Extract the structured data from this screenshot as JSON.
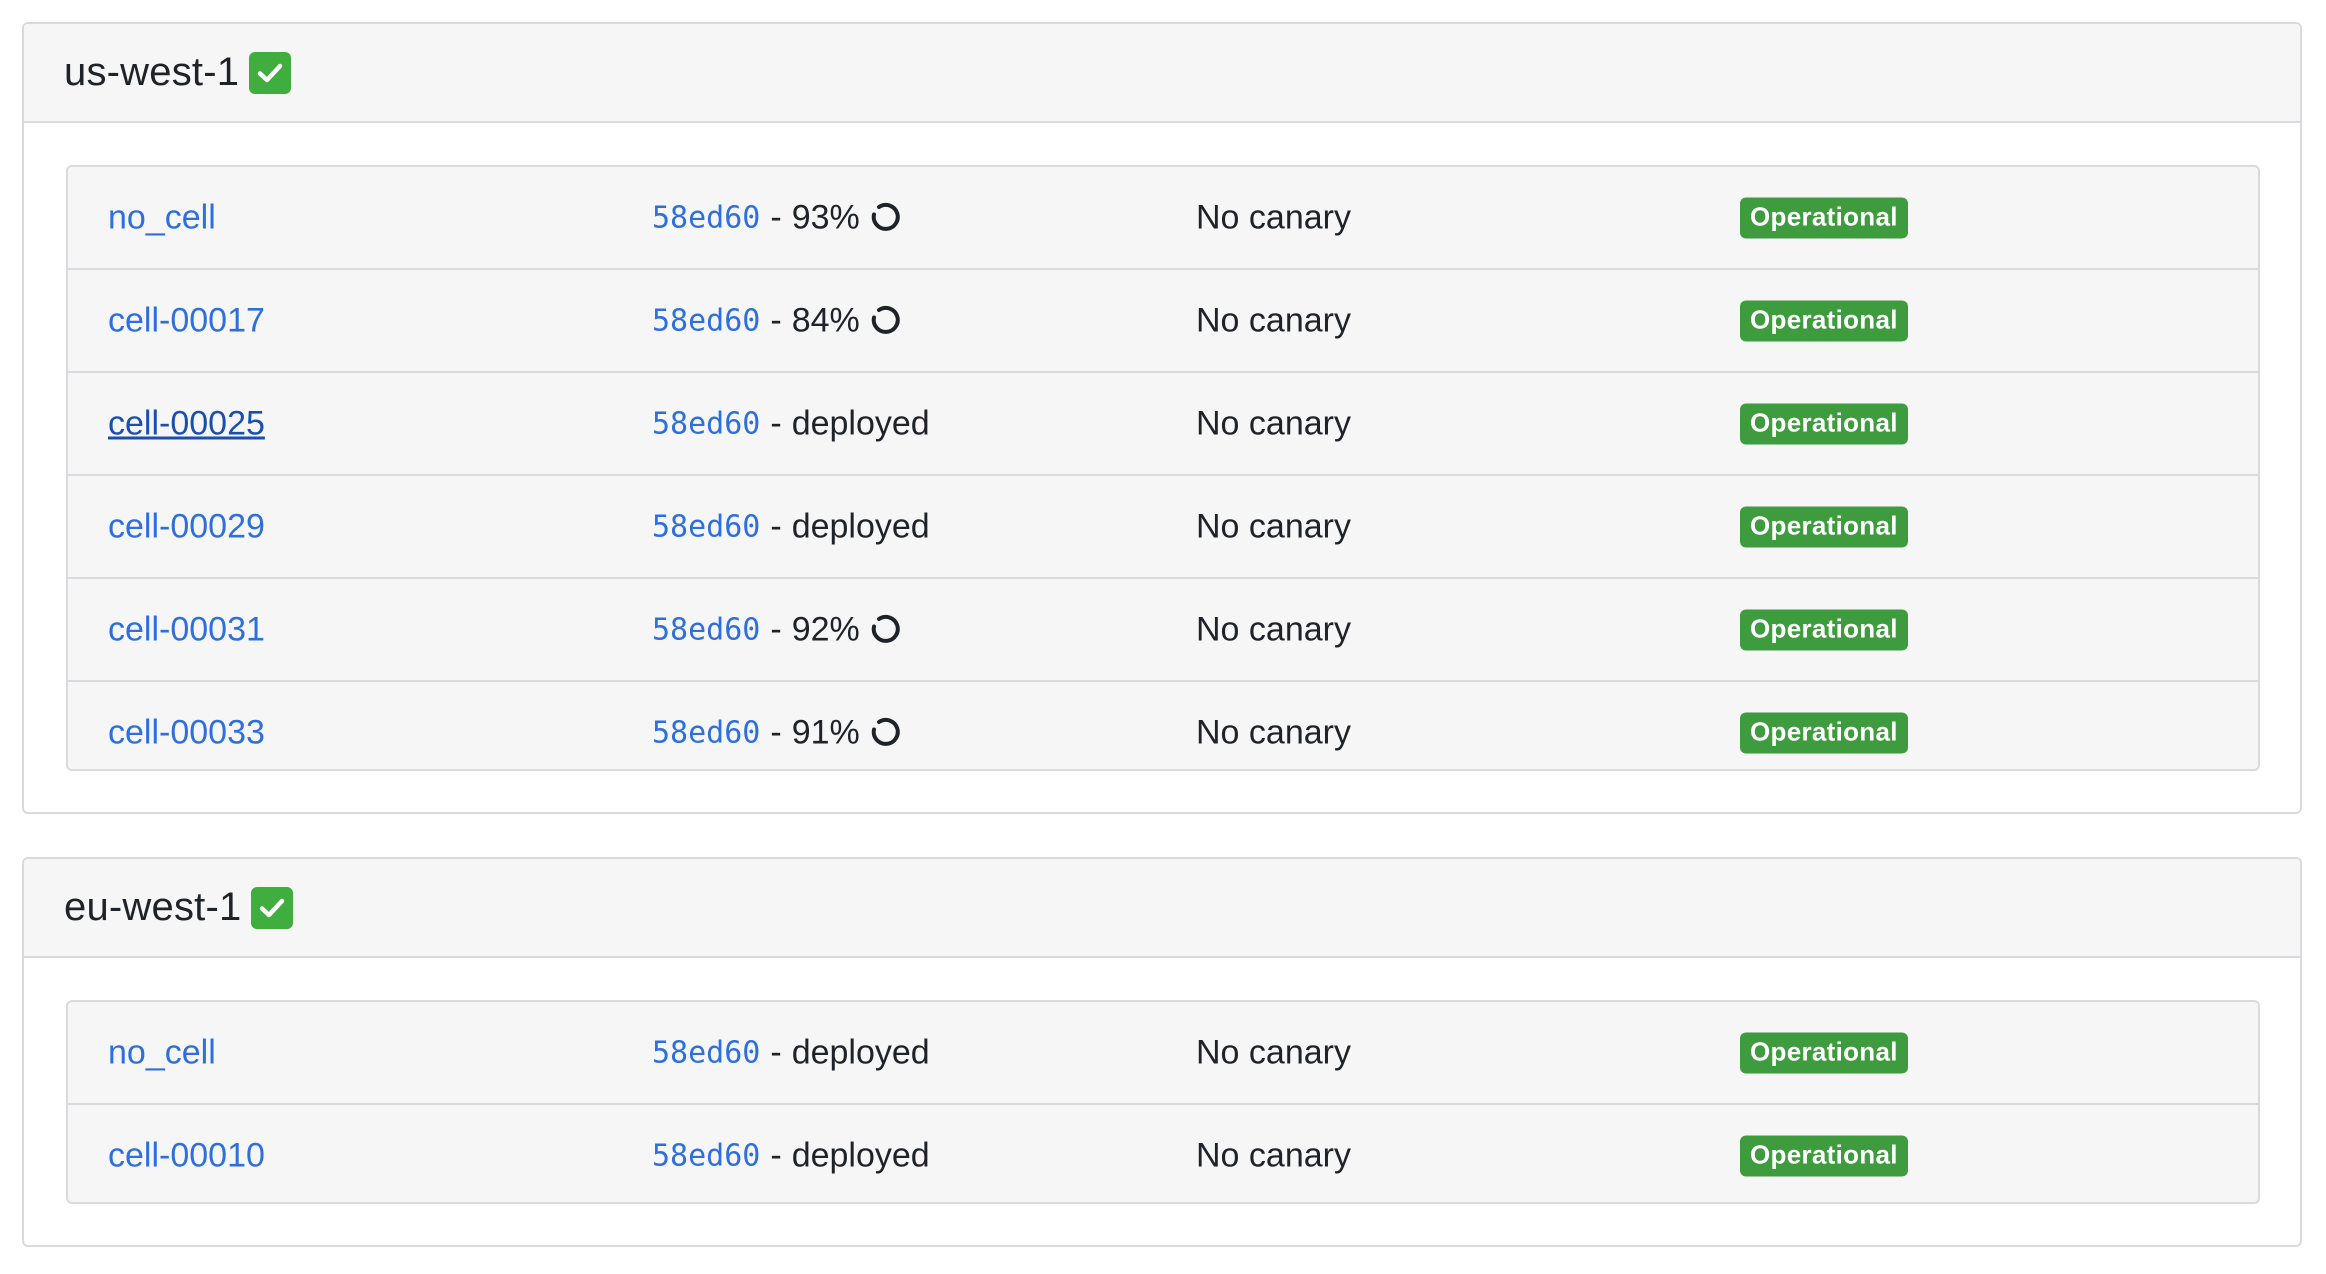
{
  "regions": [
    {
      "name": "us-west-1",
      "status_icon": "check-icon",
      "cells": [
        {
          "name": "no_cell",
          "commit": "58ed60",
          "state": "93%",
          "in_progress": true,
          "canary": "No canary",
          "status": "Operational"
        },
        {
          "name": "cell-00017",
          "commit": "58ed60",
          "state": "84%",
          "in_progress": true,
          "canary": "No canary",
          "status": "Operational"
        },
        {
          "name": "cell-00025",
          "commit": "58ed60",
          "state": "deployed",
          "in_progress": false,
          "canary": "No canary",
          "status": "Operational"
        },
        {
          "name": "cell-00029",
          "commit": "58ed60",
          "state": "deployed",
          "in_progress": false,
          "canary": "No canary",
          "status": "Operational"
        },
        {
          "name": "cell-00031",
          "commit": "58ed60",
          "state": "92%",
          "in_progress": true,
          "canary": "No canary",
          "status": "Operational"
        },
        {
          "name": "cell-00033",
          "commit": "58ed60",
          "state": "91%",
          "in_progress": true,
          "canary": "No canary",
          "status": "Operational"
        }
      ]
    },
    {
      "name": "eu-west-1",
      "status_icon": "check-icon",
      "cells": [
        {
          "name": "no_cell",
          "commit": "58ed60",
          "state": "deployed",
          "in_progress": false,
          "canary": "No canary",
          "status": "Operational"
        },
        {
          "name": "cell-00010",
          "commit": "58ed60",
          "state": "deployed",
          "in_progress": false,
          "canary": "No canary",
          "status": "Operational"
        }
      ]
    }
  ],
  "separator": "-",
  "colors": {
    "link": "#2f6fdd",
    "badge_green": "#3e9b3e",
    "check_green": "#3fae3f"
  }
}
